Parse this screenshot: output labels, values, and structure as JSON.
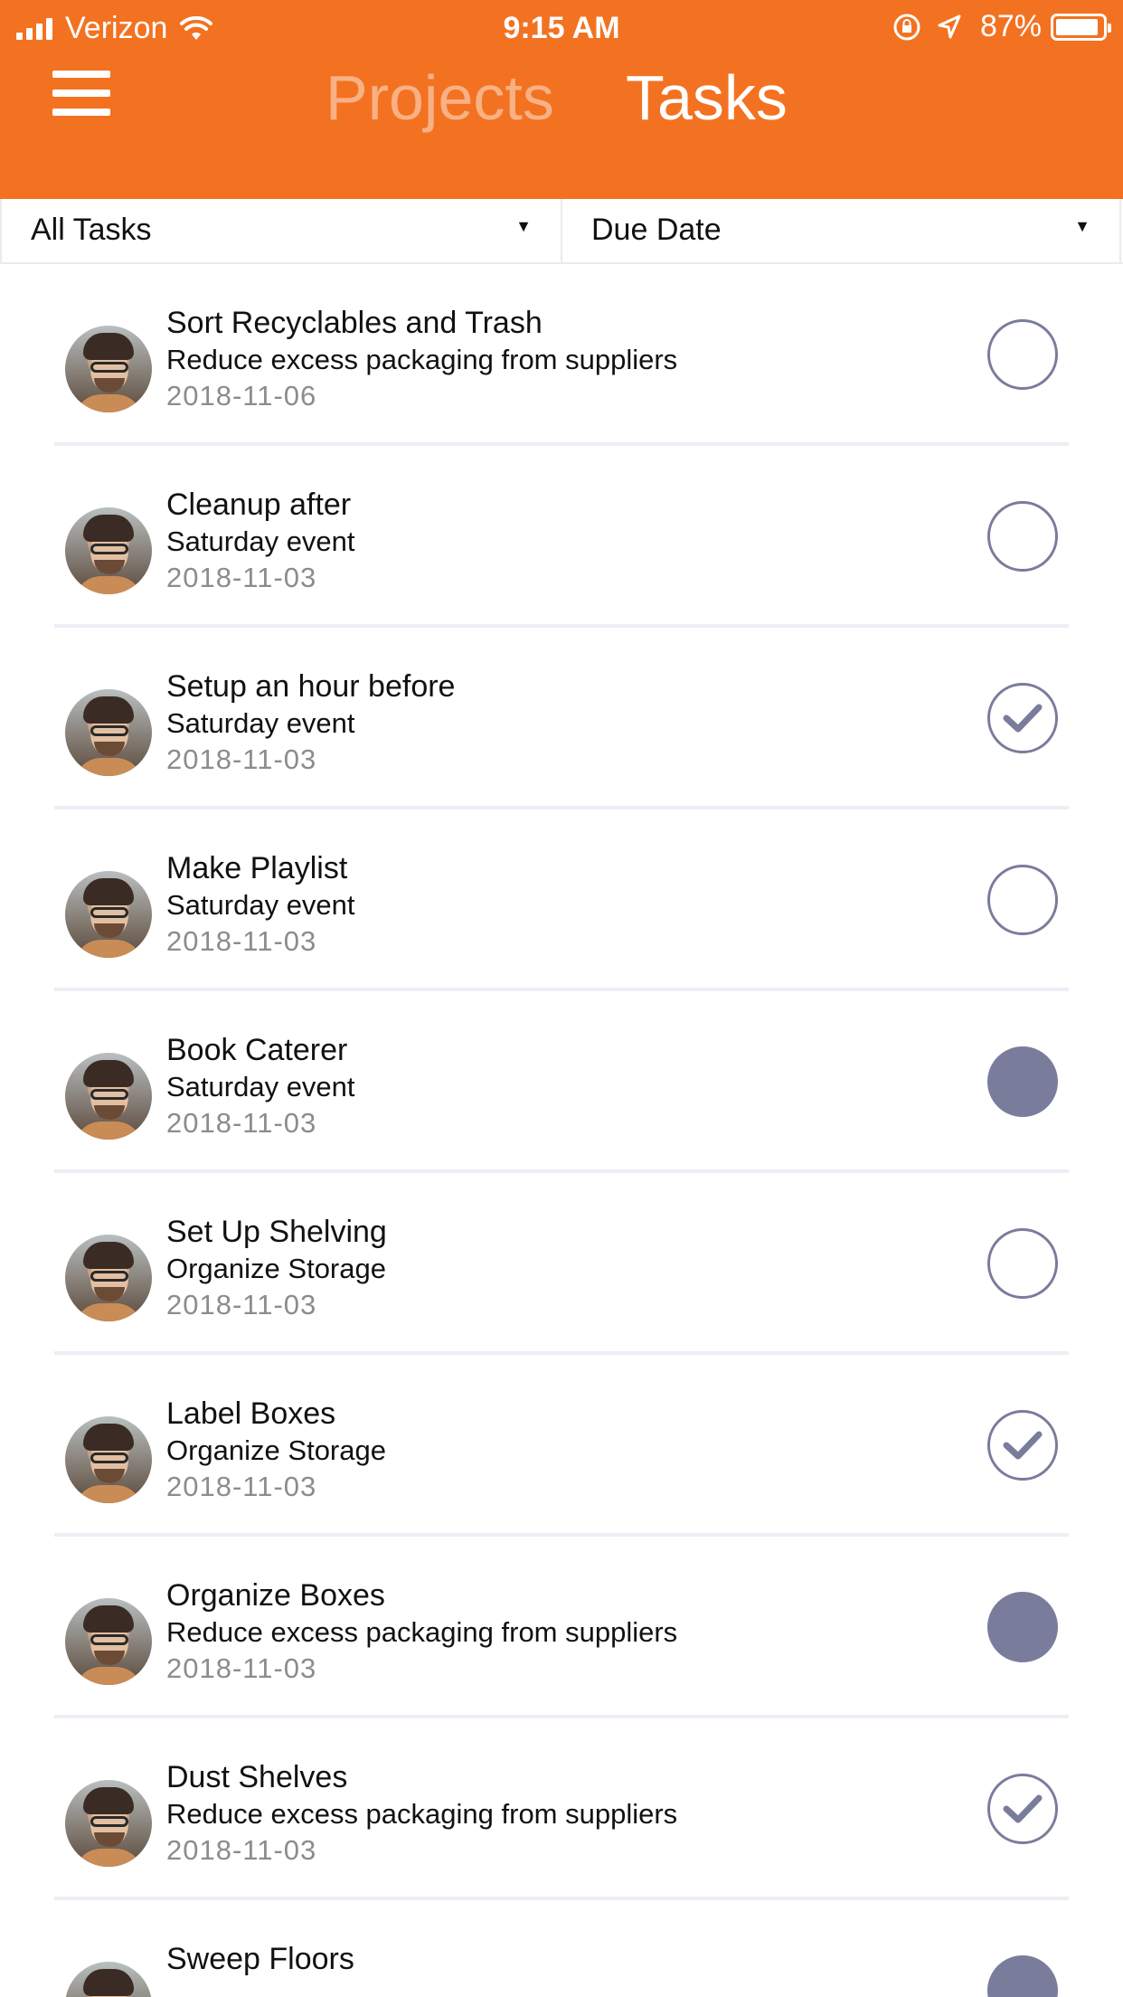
{
  "status_bar": {
    "carrier": "Verizon",
    "time": "9:15 AM",
    "battery": "87%"
  },
  "header": {
    "tabs": [
      {
        "label": "Projects",
        "active": false
      },
      {
        "label": "Tasks",
        "active": true
      }
    ],
    "accent_color": "#F37221"
  },
  "filters": {
    "scope": "All Tasks",
    "sort": "Due Date"
  },
  "tasks": [
    {
      "title": "Sort Recyclables and Trash",
      "project": "Reduce excess packaging from suppliers",
      "date": "2018-11-06",
      "status": "empty"
    },
    {
      "title": "Cleanup after",
      "project": "Saturday event",
      "date": "2018-11-03",
      "status": "empty"
    },
    {
      "title": "Setup an hour before",
      "project": "Saturday event",
      "date": "2018-11-03",
      "status": "checked"
    },
    {
      "title": "Make Playlist",
      "project": "Saturday event",
      "date": "2018-11-03",
      "status": "empty"
    },
    {
      "title": "Book Caterer",
      "project": "Saturday event",
      "date": "2018-11-03",
      "status": "filled"
    },
    {
      "title": "Set Up Shelving",
      "project": "Organize Storage",
      "date": "2018-11-03",
      "status": "empty"
    },
    {
      "title": "Label Boxes",
      "project": "Organize Storage",
      "date": "2018-11-03",
      "status": "checked"
    },
    {
      "title": "Organize Boxes",
      "project": "Reduce excess packaging from suppliers",
      "date": "2018-11-03",
      "status": "filled"
    },
    {
      "title": "Dust Shelves",
      "project": "Reduce excess packaging from suppliers",
      "date": "2018-11-03",
      "status": "checked"
    },
    {
      "title": "Sweep Floors",
      "project": "",
      "date": "",
      "status": "filled"
    }
  ],
  "colors": {
    "status_circle": "#7a7c9c",
    "divider": "#eceef5"
  }
}
